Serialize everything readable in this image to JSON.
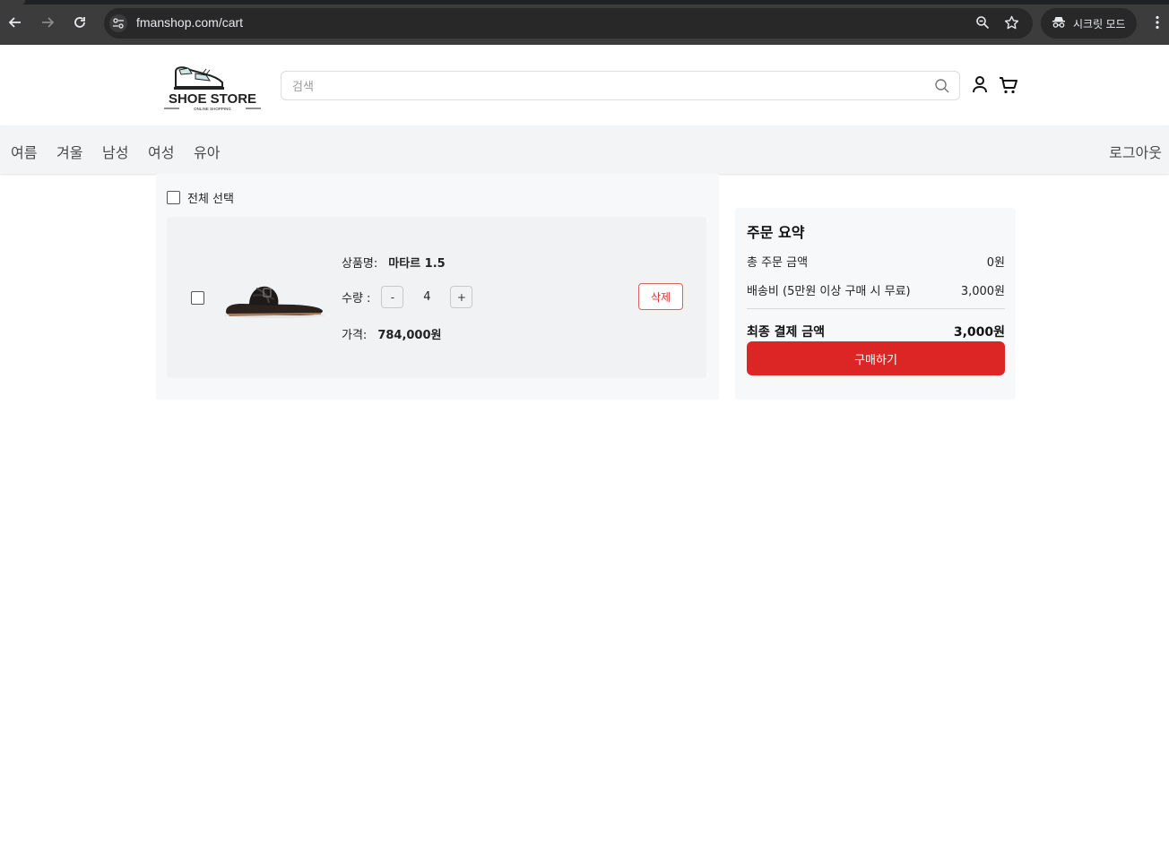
{
  "browser": {
    "url": "fmanshop.com/cart",
    "incognito_label": "시크릿 모드"
  },
  "header": {
    "logo_title": "SHOE STORE",
    "logo_subtitle": "ONLINE SHOPPING",
    "search_placeholder": "검색"
  },
  "nav": {
    "categories": [
      "여름",
      "겨울",
      "남성",
      "여성",
      "유아"
    ],
    "logout_label": "로그아웃"
  },
  "cart": {
    "select_all_label": "전체 선택",
    "items": [
      {
        "name_label": "상품명:",
        "name": "마타르 1.5",
        "quantity_label": "수량 :",
        "quantity": "4",
        "decrement_label": "-",
        "increment_label": "+",
        "price_label": "가격:",
        "price": "784,000원",
        "delete_label": "삭제"
      }
    ]
  },
  "summary": {
    "title": "주문 요약",
    "total_label": "총 주문 금액",
    "total_value": "0원",
    "shipping_label": "배송비 (5만원 이상 구매 시 무료)",
    "shipping_value": "3,000원",
    "final_label": "최종 결제 금액",
    "final_value": "3,000원",
    "buy_label": "구매하기"
  },
  "colors": {
    "accent": "#dc2626",
    "chrome_bg": "#3c3c3c"
  }
}
